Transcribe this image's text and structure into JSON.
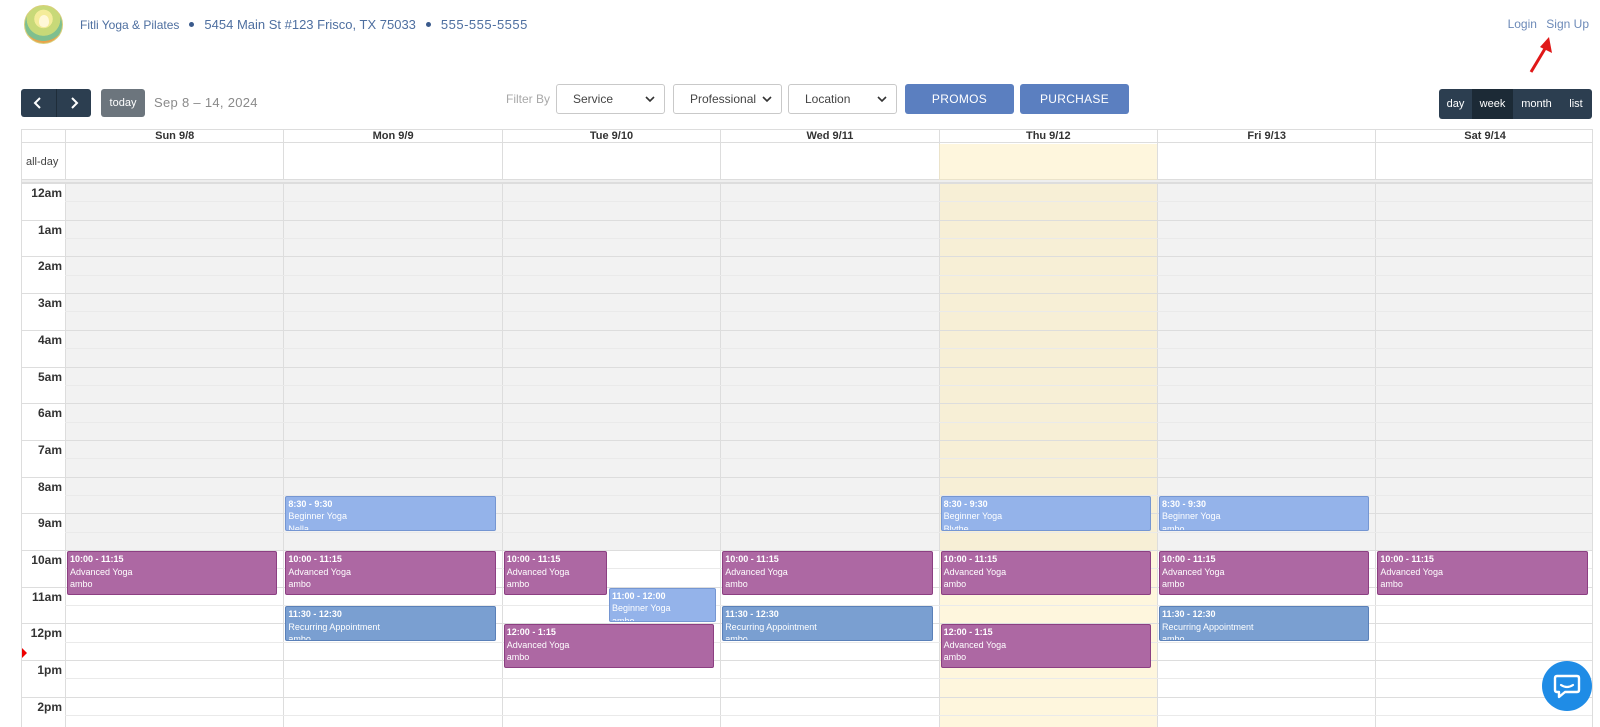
{
  "header": {
    "business_name": "Fitli Yoga & Pilates",
    "address": "5454 Main St #123 Frisco, TX 75033",
    "phone": "555-555-5555",
    "login": "Login",
    "signup": "Sign Up"
  },
  "toolbar": {
    "today": "today",
    "range": "Sep 8 – 14, 2024",
    "filter_label": "Filter By",
    "service": "Service",
    "professional": "Professional",
    "location": "Location",
    "promos": "PROMOS",
    "purchase": "PURCHASE",
    "views": [
      "day",
      "week",
      "month",
      "list"
    ],
    "active_view": "week"
  },
  "calendar": {
    "allday_label": "all-day",
    "days": [
      "Sun 9/8",
      "Mon 9/9",
      "Tue 9/10",
      "Wed 9/11",
      "Thu 9/12",
      "Fri 9/13",
      "Sat 9/14"
    ],
    "today_index": 4,
    "hours": [
      "12am",
      "1am",
      "2am",
      "3am",
      "4am",
      "5am",
      "6am",
      "7am",
      "8am",
      "9am",
      "10am",
      "11am",
      "12pm",
      "1pm",
      "2pm"
    ],
    "events": [
      {
        "day": 0,
        "start": 10.0,
        "end": 11.25,
        "time": "10:00 - 11:15",
        "title": "Advanced Yoga",
        "person": "ambo",
        "style": "purple"
      },
      {
        "day": 1,
        "start": 8.5,
        "end": 9.5,
        "time": "8:30 - 9:30",
        "title": "Beginner Yoga",
        "person": "Nella",
        "style": "light"
      },
      {
        "day": 1,
        "start": 10.0,
        "end": 11.25,
        "time": "10:00 - 11:15",
        "title": "Advanced Yoga",
        "person": "ambo",
        "style": "purple"
      },
      {
        "day": 1,
        "start": 11.5,
        "end": 12.5,
        "time": "11:30 - 12:30",
        "title": "Recurring Appointment",
        "person": "ambo",
        "style": "steel"
      },
      {
        "day": 2,
        "start": 10.0,
        "end": 11.25,
        "time": "10:00 - 11:15",
        "title": "Advanced Yoga",
        "person": "ambo",
        "style": "purple",
        "col": 0,
        "cols": 2
      },
      {
        "day": 2,
        "start": 11.0,
        "end": 12.0,
        "time": "11:00 - 12:00",
        "title": "Beginner Yoga",
        "person": "ambo",
        "style": "light",
        "col": 1,
        "cols": 2
      },
      {
        "day": 2,
        "start": 12.0,
        "end": 13.25,
        "time": "12:00 - 1:15",
        "title": "Advanced Yoga",
        "person": "ambo",
        "style": "purple"
      },
      {
        "day": 3,
        "start": 10.0,
        "end": 11.25,
        "time": "10:00 - 11:15",
        "title": "Advanced Yoga",
        "person": "ambo",
        "style": "purple"
      },
      {
        "day": 3,
        "start": 11.5,
        "end": 12.5,
        "time": "11:30 - 12:30",
        "title": "Recurring Appointment",
        "person": "ambo",
        "style": "steel"
      },
      {
        "day": 4,
        "start": 8.5,
        "end": 9.5,
        "time": "8:30 - 9:30",
        "title": "Beginner Yoga",
        "person": "Blythe",
        "style": "light"
      },
      {
        "day": 4,
        "start": 10.0,
        "end": 11.25,
        "time": "10:00 - 11:15",
        "title": "Advanced Yoga",
        "person": "ambo",
        "style": "purple"
      },
      {
        "day": 4,
        "start": 12.0,
        "end": 13.25,
        "time": "12:00 - 1:15",
        "title": "Advanced Yoga",
        "person": "ambo",
        "style": "purple"
      },
      {
        "day": 5,
        "start": 8.5,
        "end": 9.5,
        "time": "8:30 - 9:30",
        "title": "Beginner Yoga",
        "person": "ambo",
        "style": "light"
      },
      {
        "day": 5,
        "start": 10.0,
        "end": 11.25,
        "time": "10:00 - 11:15",
        "title": "Advanced Yoga",
        "person": "ambo",
        "style": "purple"
      },
      {
        "day": 5,
        "start": 11.5,
        "end": 12.5,
        "time": "11:30 - 12:30",
        "title": "Recurring Appointment",
        "person": "ambo",
        "style": "steel"
      },
      {
        "day": 6,
        "start": 10.0,
        "end": 11.25,
        "time": "10:00 - 11:15",
        "title": "Advanced Yoga",
        "person": "ambo",
        "style": "purple"
      }
    ]
  },
  "colors": {
    "nav_dark": "#2c3e50",
    "primary_button": "#5b7fc0",
    "event_purple": "#ad68a3",
    "event_light_blue": "#94b3ea",
    "event_steel_blue": "#7a9fd1",
    "today_highlight": "#fcf8e3",
    "chat_button": "#1f8ce6"
  },
  "icons": [
    "chevron-left-icon",
    "chevron-right-icon",
    "chevron-down-icon",
    "arrow-annotation-icon",
    "chat-bubble-icon"
  ]
}
